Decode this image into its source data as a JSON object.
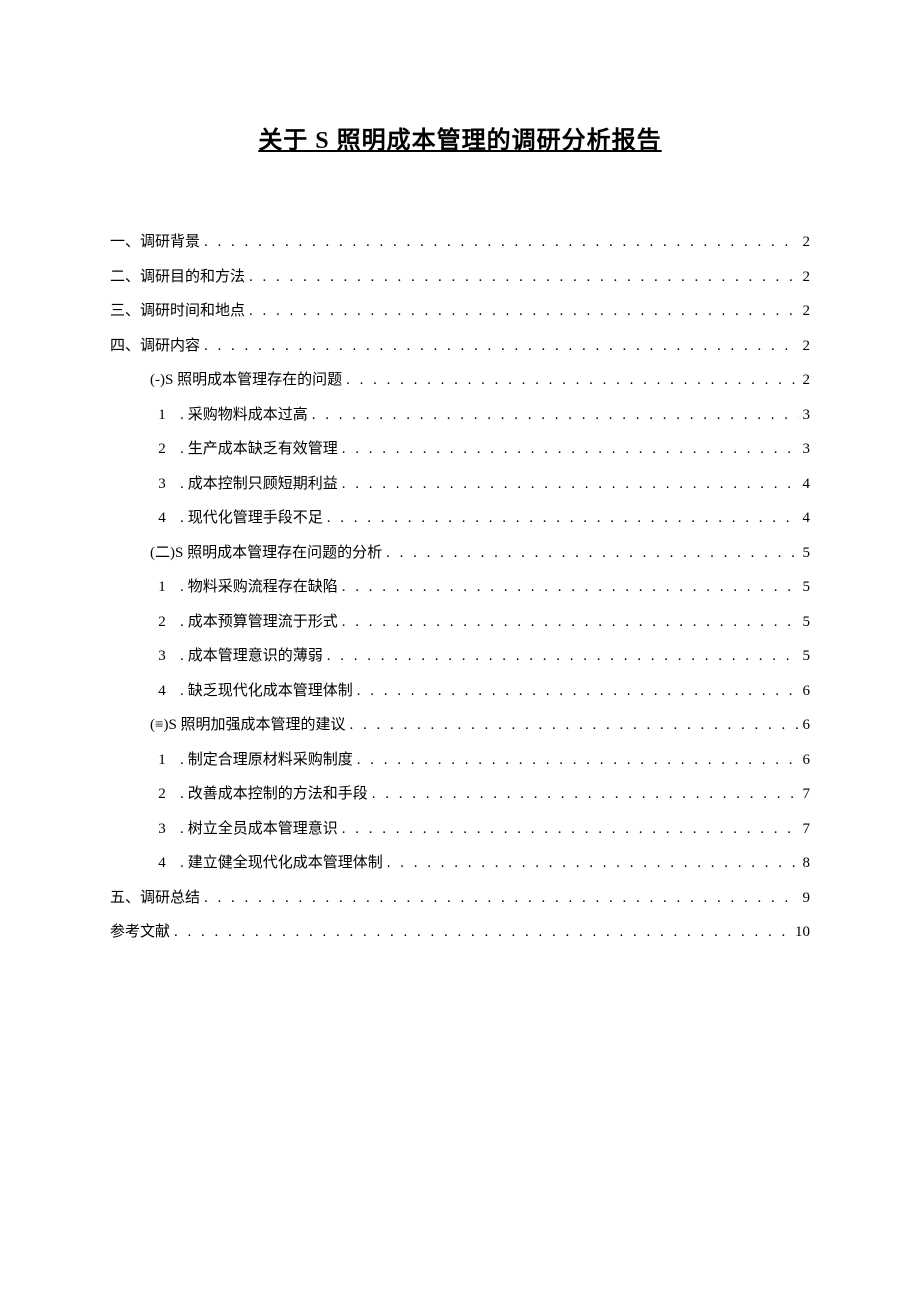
{
  "title": "关于 S 照明成本管理的调研分析报告",
  "toc": [
    {
      "level": 0,
      "label": "一、调研背景",
      "page": "2"
    },
    {
      "level": 0,
      "label": "二、调研目的和方法",
      "page": "2"
    },
    {
      "level": 0,
      "label": "三、调研时间和地点",
      "page": "2"
    },
    {
      "level": 0,
      "label": "四、调研内容",
      "page": "2"
    },
    {
      "level": 1,
      "label": "(-)S 照明成本管理存在的问题",
      "page": "2"
    },
    {
      "level": 2,
      "num": "1",
      "label": "采购物料成本过高",
      "page": "3"
    },
    {
      "level": 2,
      "num": "2",
      "label": "生产成本缺乏有效管理",
      "page": "3"
    },
    {
      "level": 2,
      "num": "3",
      "label": "成本控制只顾短期利益",
      "page": "4"
    },
    {
      "level": 2,
      "num": "4",
      "label": "现代化管理手段不足",
      "page": "4"
    },
    {
      "level": 1,
      "label": "(二)S 照明成本管理存在问题的分析",
      "page": "5"
    },
    {
      "level": 2,
      "num": "1",
      "label": "物料采购流程存在缺陷",
      "page": "5"
    },
    {
      "level": 2,
      "num": "2",
      "label": "成本预算管理流于形式",
      "page": "5"
    },
    {
      "level": 2,
      "num": "3",
      "label": "成本管理意识的薄弱",
      "page": "5"
    },
    {
      "level": 2,
      "num": "4",
      "label": "缺乏现代化成本管理体制",
      "page": "6"
    },
    {
      "level": 1,
      "label": "(≡)S 照明加强成本管理的建议",
      "page": "6"
    },
    {
      "level": 2,
      "num": "1",
      "label": "制定合理原材料采购制度",
      "page": "6"
    },
    {
      "level": 2,
      "num": "2",
      "label": "改善成本控制的方法和手段",
      "page": "7"
    },
    {
      "level": 2,
      "num": "3",
      "label": "树立全员成本管理意识",
      "page": "7"
    },
    {
      "level": 2,
      "num": "4",
      "label": "建立健全现代化成本管理体制",
      "page": "8"
    },
    {
      "level": 0,
      "label": "五、调研总结",
      "page": "9"
    },
    {
      "level": 0,
      "label": "参考文献",
      "page": "10"
    }
  ]
}
